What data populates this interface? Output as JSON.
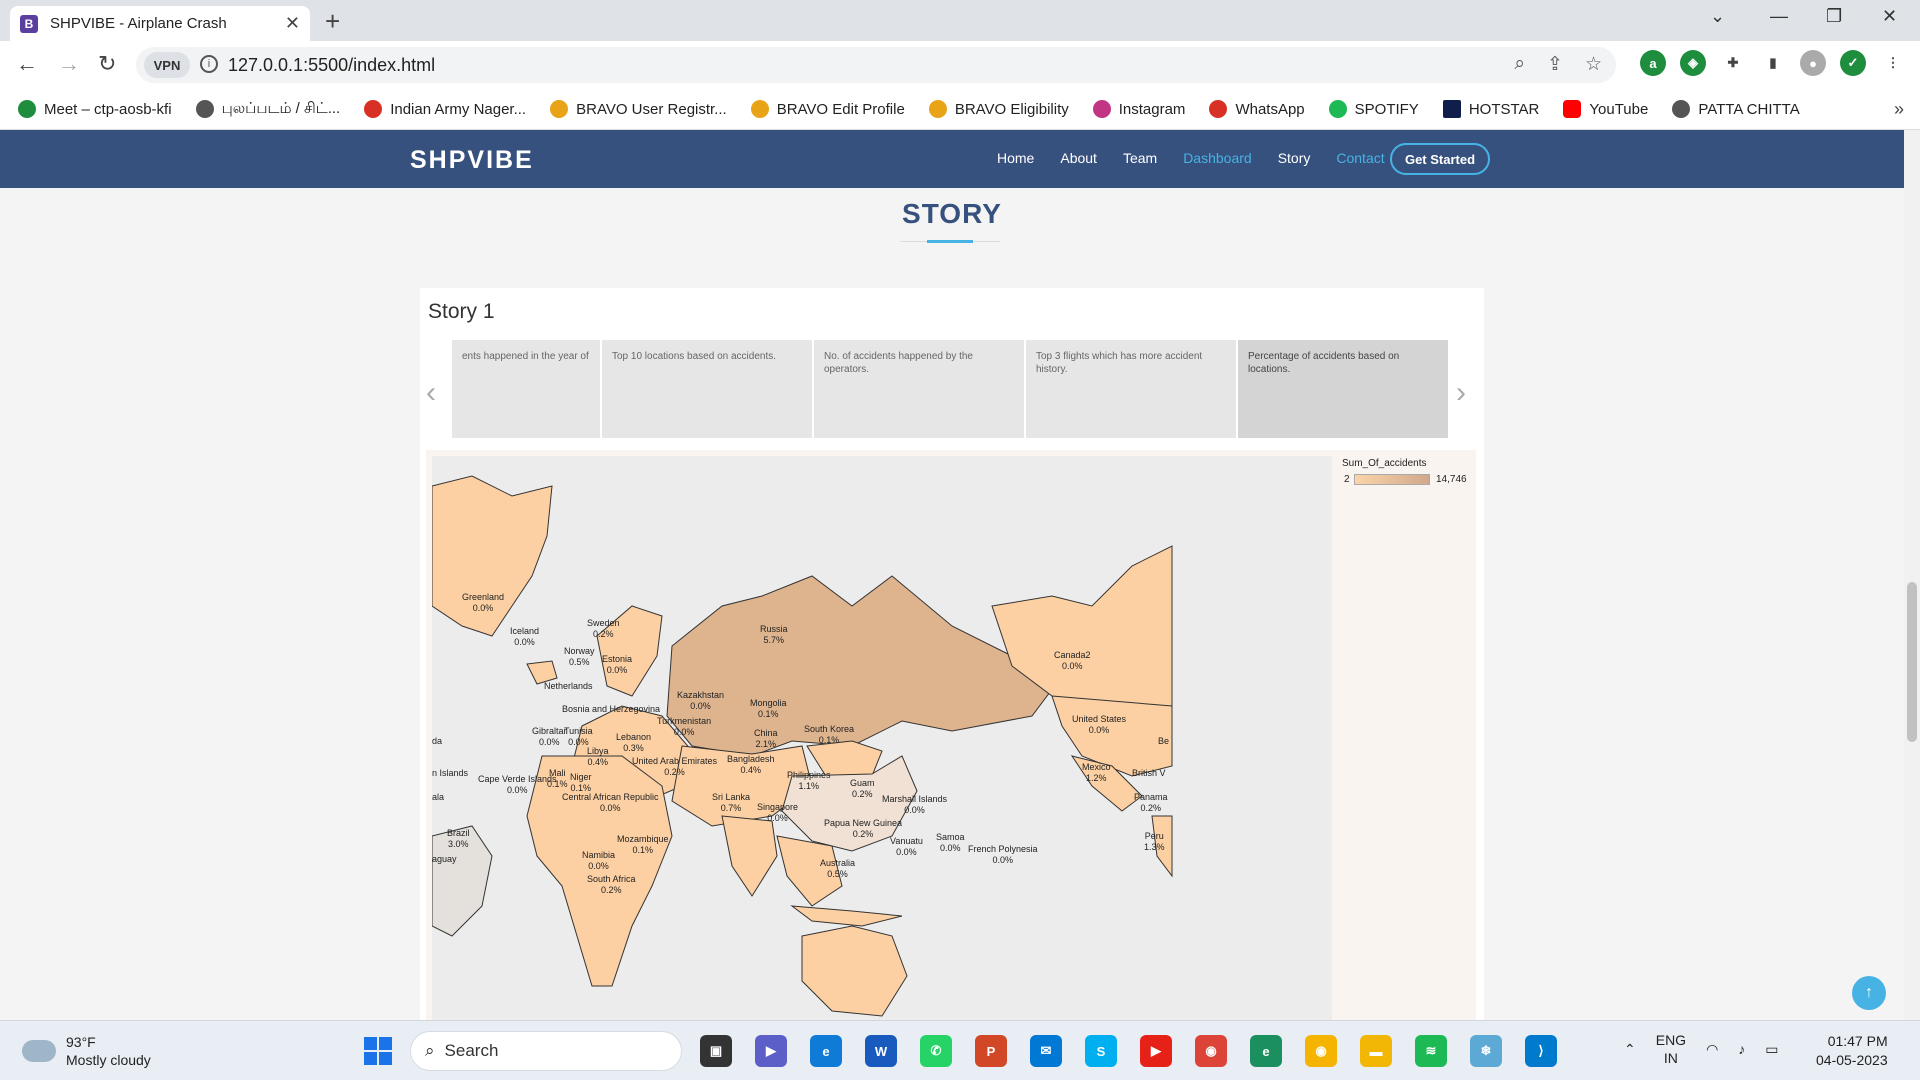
{
  "browser": {
    "tab_title": "SHPVIBE - Airplane Crash",
    "tab_favicon": "B",
    "url": "127.0.0.1:5500/index.html",
    "vpn_label": "VPN"
  },
  "bookmarks": [
    {
      "label": "Meet – ctp-aosb-kfi",
      "color": "#1e8e3e"
    },
    {
      "label": "புலப்படம் / சிட்...",
      "color": "#555555"
    },
    {
      "label": "Indian Army Nager...",
      "color": "#d93025"
    },
    {
      "label": "BRAVO User Registr...",
      "color": "#e8a317"
    },
    {
      "label": "BRAVO Edit Profile",
      "color": "#e8a317"
    },
    {
      "label": "BRAVO Eligibility",
      "color": "#e8a317"
    },
    {
      "label": "Instagram",
      "color": "#c13584"
    },
    {
      "label": "WhatsApp",
      "color": "#d93025"
    },
    {
      "label": "SPOTIFY",
      "color": "#1db954"
    },
    {
      "label": "HOTSTAR",
      "color": "#0f1e4b"
    },
    {
      "label": "YouTube",
      "color": "#ff0000"
    },
    {
      "label": "PATTA CHITTA",
      "color": "#555555"
    }
  ],
  "site": {
    "logo": "SHPVIBE",
    "nav": [
      {
        "label": "Home",
        "active": false
      },
      {
        "label": "About",
        "active": false
      },
      {
        "label": "Team",
        "active": false
      },
      {
        "label": "Dashboard",
        "active": true
      },
      {
        "label": "Story",
        "active": false
      },
      {
        "label": "Contact",
        "active": true
      }
    ],
    "cta": "Get Started",
    "section_title": "STORY"
  },
  "story": {
    "title": "Story 1",
    "points": [
      "ents happened in the year of",
      "Top 10 locations based on accidents.",
      "No. of accidents happened by the operators.",
      "Top 3 flights which has more accident history.",
      "Percentage of accidents based on locations."
    ],
    "legend": {
      "title": "Sum_Of_accidents",
      "min": "2",
      "max": "14,746"
    },
    "countries": [
      {
        "name": "Greenland",
        "pct": "0.0%"
      },
      {
        "name": "Iceland",
        "pct": "0.0%"
      },
      {
        "name": "Sweden",
        "pct": "0.2%"
      },
      {
        "name": "Norway",
        "pct": "0.5%"
      },
      {
        "name": "Estonia",
        "pct": "0.0%"
      },
      {
        "name": "Netherlands",
        "pct": ""
      },
      {
        "name": "Russia",
        "pct": "5.7%"
      },
      {
        "name": "Kazakhstan",
        "pct": "0.0%"
      },
      {
        "name": "Mongolia",
        "pct": "0.1%"
      },
      {
        "name": "Bosnia and Herzegovina",
        "pct": ""
      },
      {
        "name": "Turkmenistan",
        "pct": "0.0%"
      },
      {
        "name": "Gibraltar",
        "pct": "0.0%"
      },
      {
        "name": "Tunisia",
        "pct": "0.0%"
      },
      {
        "name": "Lebanon",
        "pct": "0.3%"
      },
      {
        "name": "China",
        "pct": "2.1%"
      },
      {
        "name": "South Korea",
        "pct": "0.1%"
      },
      {
        "name": "Libya",
        "pct": "0.4%"
      },
      {
        "name": "United Arab Emirates",
        "pct": "0.2%"
      },
      {
        "name": "Bangladesh",
        "pct": "0.4%"
      },
      {
        "name": "Philippines",
        "pct": "1.1%"
      },
      {
        "name": "Mali",
        "pct": "0.1%"
      },
      {
        "name": "Niger",
        "pct": "0.1%"
      },
      {
        "name": "Cape Verde Islands",
        "pct": "0.0%"
      },
      {
        "name": "Central African Republic",
        "pct": "0.0%"
      },
      {
        "name": "Sri Lanka",
        "pct": "0.7%"
      },
      {
        "name": "Singapore",
        "pct": "0.0%"
      },
      {
        "name": "Guam",
        "pct": "0.2%"
      },
      {
        "name": "Marshall Islands",
        "pct": "0.0%"
      },
      {
        "name": "Papua New Guinea",
        "pct": "0.2%"
      },
      {
        "name": "Mozambique",
        "pct": "0.1%"
      },
      {
        "name": "Namibia",
        "pct": "0.0%"
      },
      {
        "name": "South Africa",
        "pct": "0.2%"
      },
      {
        "name": "Brazil",
        "pct": "3.0%"
      },
      {
        "name": "Vanuatu",
        "pct": "0.0%"
      },
      {
        "name": "Samoa",
        "pct": "0.0%"
      },
      {
        "name": "French Polynesia",
        "pct": "0.0%"
      },
      {
        "name": "Australia",
        "pct": "0.5%"
      },
      {
        "name": "Canada2",
        "pct": "0.0%"
      },
      {
        "name": "United States",
        "pct": "0.0%"
      },
      {
        "name": "Mexico",
        "pct": "1.2%"
      },
      {
        "name": "Panama",
        "pct": "0.2%"
      },
      {
        "name": "Peru",
        "pct": "1.3%"
      }
    ],
    "edge_labels": [
      "da",
      "n Islands",
      "ala",
      "aguay",
      "Be",
      "British V",
      "Peru"
    ]
  },
  "taskbar": {
    "temp": "93°F",
    "weather": "Mostly cloudy",
    "search": "Search",
    "lang_top": "ENG",
    "lang_bottom": "IN",
    "time": "01:47 PM",
    "date": "04-05-2023",
    "mail_badge": "1"
  },
  "colors": {
    "header_bg": "#37517e",
    "accent": "#47b2e4",
    "land_low": "#fcd4a9",
    "land_high": "#d0a88c",
    "russia": "#deb48e",
    "china": "#f0e1d4"
  }
}
